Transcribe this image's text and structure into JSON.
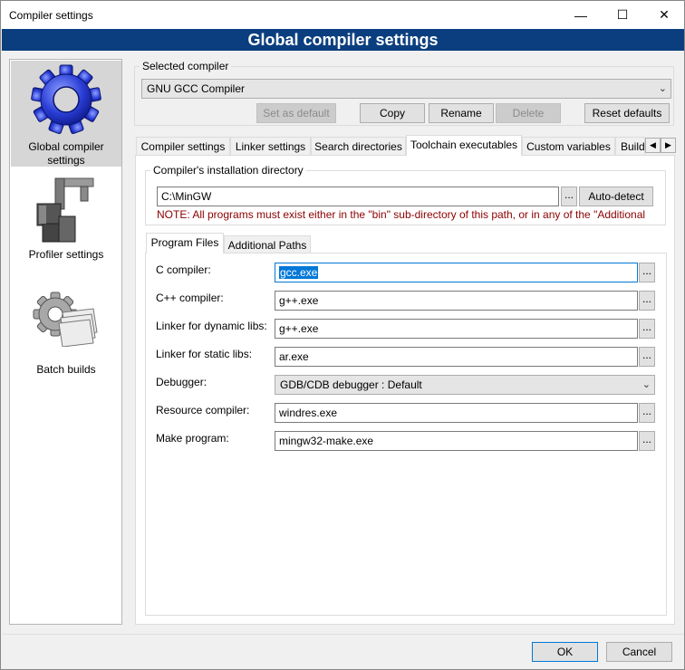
{
  "window": {
    "title": "Compiler settings",
    "minimize_glyph": "—",
    "maximize_glyph": "☐",
    "close_glyph": "✕"
  },
  "banner": "Global compiler settings",
  "left_list": {
    "items": [
      {
        "label_line1": "Global compiler",
        "label_line2": "settings",
        "icon": "gear-icon",
        "selected": true
      },
      {
        "label_line1": "Profiler settings",
        "label_line2": "",
        "icon": "caliper-icon",
        "selected": false
      },
      {
        "label_line1": "Batch builds",
        "label_line2": "",
        "icon": "batch-gear-icon",
        "selected": false
      }
    ]
  },
  "selected_compiler": {
    "group_label": "Selected compiler",
    "value": "GNU GCC Compiler",
    "buttons": {
      "set_default": "Set as default",
      "copy": "Copy",
      "rename": "Rename",
      "delete": "Delete",
      "reset": "Reset defaults"
    }
  },
  "tabs": [
    {
      "label": "Compiler settings"
    },
    {
      "label": "Linker settings"
    },
    {
      "label": "Search directories"
    },
    {
      "label": "Toolchain executables",
      "active": true
    },
    {
      "label": "Custom variables"
    },
    {
      "label": "Build"
    }
  ],
  "tab_scroll": {
    "left": "◀",
    "right": "▶"
  },
  "install_dir": {
    "group_label": "Compiler's installation directory",
    "value": "C:\\MinGW",
    "browse": "...",
    "auto_detect": "Auto-detect",
    "note": "NOTE: All programs must exist either in the \"bin\" sub-directory of this path, or in any of the \"Additional"
  },
  "inner_tabs": [
    {
      "label": "Program Files",
      "active": true
    },
    {
      "label": "Additional Paths"
    }
  ],
  "programs": {
    "c_compiler": {
      "label": "C compiler:",
      "value": "gcc.exe"
    },
    "cpp_compiler": {
      "label": "C++ compiler:",
      "value": "g++.exe"
    },
    "linker_dynamic": {
      "label": "Linker for dynamic libs:",
      "value": "g++.exe"
    },
    "linker_static": {
      "label": "Linker for static libs:",
      "value": "ar.exe"
    },
    "debugger": {
      "label": "Debugger:",
      "value": "GDB/CDB debugger : Default"
    },
    "resource_compiler": {
      "label": "Resource compiler:",
      "value": "windres.exe"
    },
    "make_program": {
      "label": "Make program:",
      "value": "mingw32-make.exe"
    },
    "browse": "..."
  },
  "footer": {
    "ok": "OK",
    "cancel": "Cancel"
  }
}
